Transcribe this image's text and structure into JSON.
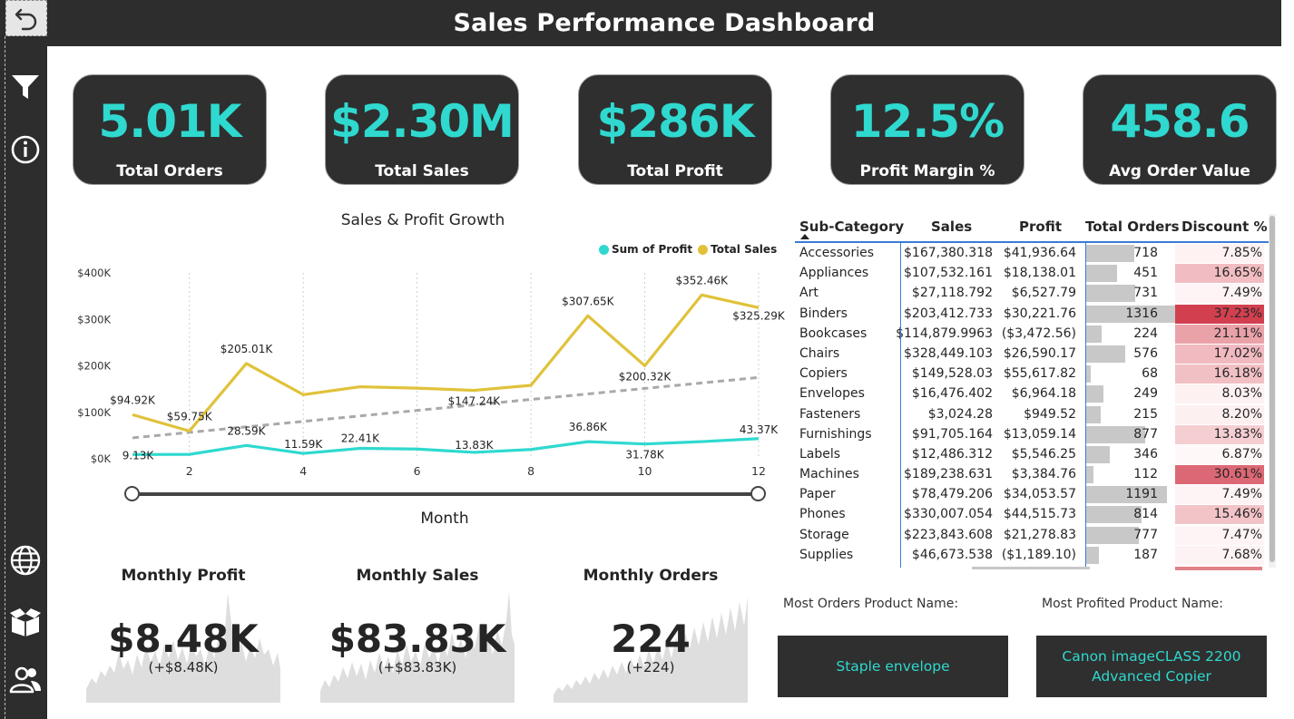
{
  "header": {
    "title": "Sales Performance Dashboard"
  },
  "sidebar": {
    "icons": [
      "undo-icon",
      "filter-icon",
      "info-icon",
      "globe-icon",
      "box-icon",
      "users-icon"
    ]
  },
  "kpis": [
    {
      "value": "5.01K",
      "label": "Total Orders"
    },
    {
      "value": "$2.30M",
      "label": "Total Sales"
    },
    {
      "value": "$286K",
      "label": "Total Profit"
    },
    {
      "value": "12.5%",
      "label": "Profit Margin %"
    },
    {
      "value": "458.6",
      "label": "Avg Order Value"
    }
  ],
  "colors": {
    "accent": "#2fd9cf",
    "sales_line": "#e0c23a",
    "profit_line": "#2fd9cf",
    "dark": "#2d2d2d",
    "discount_high": "#d9404f"
  },
  "chart": {
    "title": "Sales & Profit Growth",
    "legend": [
      "Sum of Profit",
      "Total Sales"
    ],
    "xlabel": "Month"
  },
  "chart_data": {
    "type": "line",
    "title": "Sales & Profit Growth",
    "xlabel": "Month",
    "ylabel": "",
    "x": [
      1,
      2,
      3,
      4,
      5,
      6,
      7,
      8,
      9,
      10,
      11,
      12
    ],
    "x_ticks": [
      "2",
      "4",
      "6",
      "8",
      "10",
      "12"
    ],
    "y_ticks": [
      "$0K",
      "$100K",
      "$200K",
      "$300K",
      "$400K"
    ],
    "ylim": [
      0,
      400000
    ],
    "series": [
      {
        "name": "Total Sales",
        "color": "#e0c23a",
        "values": [
          94920,
          59750,
          205010,
          138000,
          155000,
          152000,
          147240,
          158000,
          307650,
          200320,
          352460,
          325290
        ],
        "labels": [
          "$94.92K",
          "$59.75K",
          "$205.01K",
          "",
          "",
          "",
          "$147.24K",
          "",
          "$307.65K",
          "$200.32K",
          "$352.46K",
          "$325.29K"
        ]
      },
      {
        "name": "Sum of Profit",
        "color": "#2fd9cf",
        "values": [
          9130,
          9500,
          28590,
          11590,
          22410,
          21000,
          13830,
          20000,
          36860,
          31780,
          37000,
          43370
        ],
        "labels": [
          "9.13K",
          "",
          "28.59K",
          "11.59K",
          "22.41K",
          "",
          "13.83K",
          "",
          "36.86K",
          "31.78K",
          "",
          "43.37K"
        ]
      }
    ],
    "trendline": {
      "from": 45000,
      "to": 175000
    },
    "grid": "vertical-dotted",
    "legend_position": "top-right"
  },
  "table": {
    "headers": [
      "Sub-Category",
      "Sales",
      "Profit",
      "Total Orders",
      "Discount %"
    ],
    "rows": [
      {
        "name": "Accessories",
        "sales": "$167,380.318",
        "profit": "$41,936.64",
        "orders": 718,
        "orders_label": "718",
        "discount": 7.85,
        "discount_label": "7.85%"
      },
      {
        "name": "Appliances",
        "sales": "$107,532.161",
        "profit": "$18,138.01",
        "orders": 451,
        "orders_label": "451",
        "discount": 16.65,
        "discount_label": "16.65%"
      },
      {
        "name": "Art",
        "sales": "$27,118.792",
        "profit": "$6,527.79",
        "orders": 731,
        "orders_label": "731",
        "discount": 7.49,
        "discount_label": "7.49%"
      },
      {
        "name": "Binders",
        "sales": "$203,412.733",
        "profit": "$30,221.76",
        "orders": 1316,
        "orders_label": "1316",
        "discount": 37.23,
        "discount_label": "37.23%"
      },
      {
        "name": "Bookcases",
        "sales": "$114,879.9963",
        "profit": "($3,472.56)",
        "orders": 224,
        "orders_label": "224",
        "discount": 21.11,
        "discount_label": "21.11%"
      },
      {
        "name": "Chairs",
        "sales": "$328,449.103",
        "profit": "$26,590.17",
        "orders": 576,
        "orders_label": "576",
        "discount": 17.02,
        "discount_label": "17.02%"
      },
      {
        "name": "Copiers",
        "sales": "$149,528.03",
        "profit": "$55,617.82",
        "orders": 68,
        "orders_label": "68",
        "discount": 16.18,
        "discount_label": "16.18%"
      },
      {
        "name": "Envelopes",
        "sales": "$16,476.402",
        "profit": "$6,964.18",
        "orders": 249,
        "orders_label": "249",
        "discount": 8.03,
        "discount_label": "8.03%"
      },
      {
        "name": "Fasteners",
        "sales": "$3,024.28",
        "profit": "$949.52",
        "orders": 215,
        "orders_label": "215",
        "discount": 8.2,
        "discount_label": "8.20%"
      },
      {
        "name": "Furnishings",
        "sales": "$91,705.164",
        "profit": "$13,059.14",
        "orders": 877,
        "orders_label": "877",
        "discount": 13.83,
        "discount_label": "13.83%"
      },
      {
        "name": "Labels",
        "sales": "$12,486.312",
        "profit": "$5,546.25",
        "orders": 346,
        "orders_label": "346",
        "discount": 6.87,
        "discount_label": "6.87%"
      },
      {
        "name": "Machines",
        "sales": "$189,238.631",
        "profit": "$3,384.76",
        "orders": 112,
        "orders_label": "112",
        "discount": 30.61,
        "discount_label": "30.61%"
      },
      {
        "name": "Paper",
        "sales": "$78,479.206",
        "profit": "$34,053.57",
        "orders": 1191,
        "orders_label": "1191",
        "discount": 7.49,
        "discount_label": "7.49%"
      },
      {
        "name": "Phones",
        "sales": "$330,007.054",
        "profit": "$44,515.73",
        "orders": 814,
        "orders_label": "814",
        "discount": 15.46,
        "discount_label": "15.46%"
      },
      {
        "name": "Storage",
        "sales": "$223,843.608",
        "profit": "$21,278.83",
        "orders": 777,
        "orders_label": "777",
        "discount": 7.47,
        "discount_label": "7.47%"
      },
      {
        "name": "Supplies",
        "sales": "$46,673.538",
        "profit": "($1,189.10)",
        "orders": 187,
        "orders_label": "187",
        "discount": 7.68,
        "discount_label": "7.68%"
      }
    ]
  },
  "products": {
    "most_orders_label": "Most Orders Product Name:",
    "most_orders_value": "Staple envelope",
    "most_profited_label": "Most Profited Product Name:",
    "most_profited_value": "Canon imageCLASS 2200 Advanced Copier"
  },
  "monthly": [
    {
      "title": "Monthly Profit",
      "value": "$8.48K",
      "change": "(+$8.48K)"
    },
    {
      "title": "Monthly Sales",
      "value": "$83.83K",
      "change": "(+$83.83K)"
    },
    {
      "title": "Monthly Orders",
      "value": "224",
      "change": "(+224)"
    }
  ]
}
